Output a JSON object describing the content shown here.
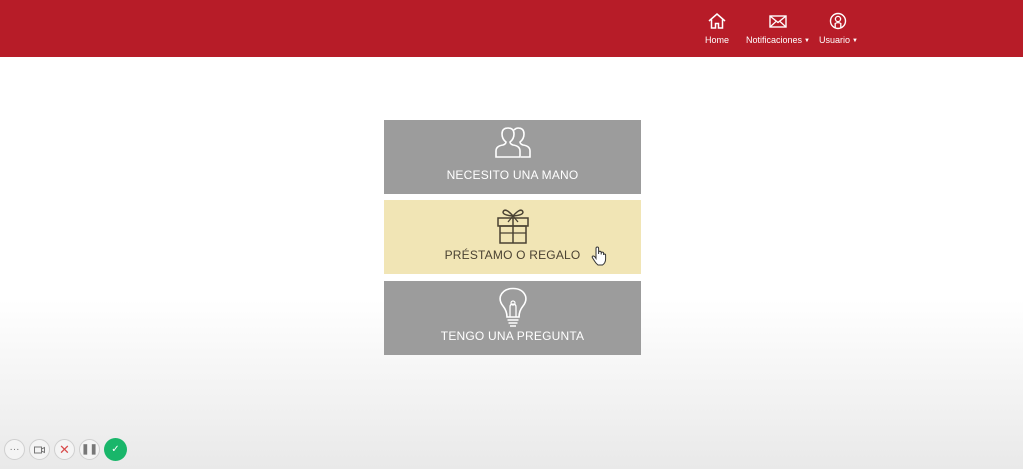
{
  "nav": {
    "home_label": "Home",
    "notifications_label": "Notificaciones",
    "user_label": "Usuario"
  },
  "cards": [
    {
      "title": "NECESITO UNA MANO",
      "icon": "people-icon",
      "color": "#9c9c9c"
    },
    {
      "title": "PRÉSTAMO O REGALO",
      "icon": "gift-icon",
      "color": "#f1e5b5"
    },
    {
      "title": "TENGO UNA PREGUNTA",
      "icon": "lightbulb-icon",
      "color": "#9c9c9c"
    }
  ],
  "colors": {
    "brand": "#b71c28",
    "success": "#19b66a"
  },
  "recorder_controls": [
    "more-icon",
    "camera-icon",
    "close-icon",
    "pause-icon",
    "check-icon"
  ]
}
